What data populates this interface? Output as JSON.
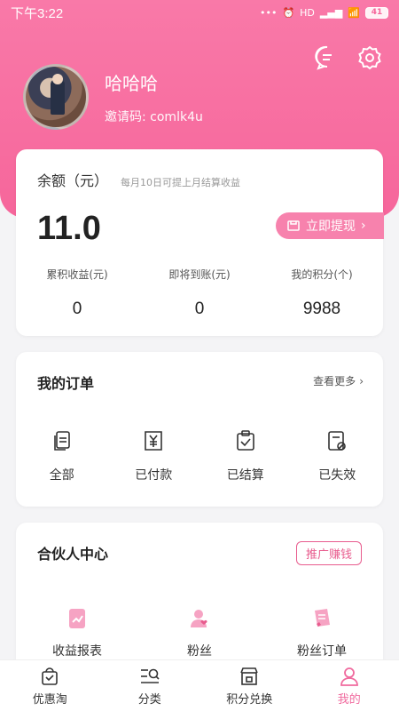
{
  "statusbar": {
    "time": "下午3:22",
    "signal": "HD",
    "battery": "41"
  },
  "profile": {
    "nickname": "哈哈哈",
    "invite": "邀请码: comlk4u"
  },
  "balance": {
    "label": "余额（元）",
    "hint": "每月10日可提上月结算收益",
    "amount": "11.0",
    "withdraw_label": "立即提现",
    "stats": [
      {
        "title": "累积收益(元)",
        "value": "0"
      },
      {
        "title": "即将到账(元)",
        "value": "0"
      },
      {
        "title": "我的积分(个)",
        "value": "9988"
      }
    ]
  },
  "orders": {
    "title": "我的订单",
    "more": "查看更多",
    "items": [
      {
        "label": "全部",
        "icon": "document-copy-icon"
      },
      {
        "label": "已付款",
        "icon": "yuan-receipt-icon"
      },
      {
        "label": "已结算",
        "icon": "clipboard-check-icon"
      },
      {
        "label": "已失效",
        "icon": "document-cancel-icon"
      }
    ]
  },
  "partner": {
    "title": "合伙人中心",
    "promo": "推广赚钱",
    "items": [
      {
        "label": "收益报表",
        "icon": "report-icon"
      },
      {
        "label": "粉丝",
        "icon": "fans-icon"
      },
      {
        "label": "粉丝订单",
        "icon": "fans-order-icon"
      }
    ]
  },
  "tabbar": [
    {
      "label": "优惠淘",
      "icon": "shopping-bag-icon"
    },
    {
      "label": "分类",
      "icon": "category-search-icon"
    },
    {
      "label": "积分兑换",
      "icon": "store-icon"
    },
    {
      "label": "我的",
      "icon": "user-icon",
      "active": true
    }
  ],
  "colors": {
    "brand": "#f6669b",
    "accent": "#f782ad",
    "active_tab": "#f06a9e"
  }
}
